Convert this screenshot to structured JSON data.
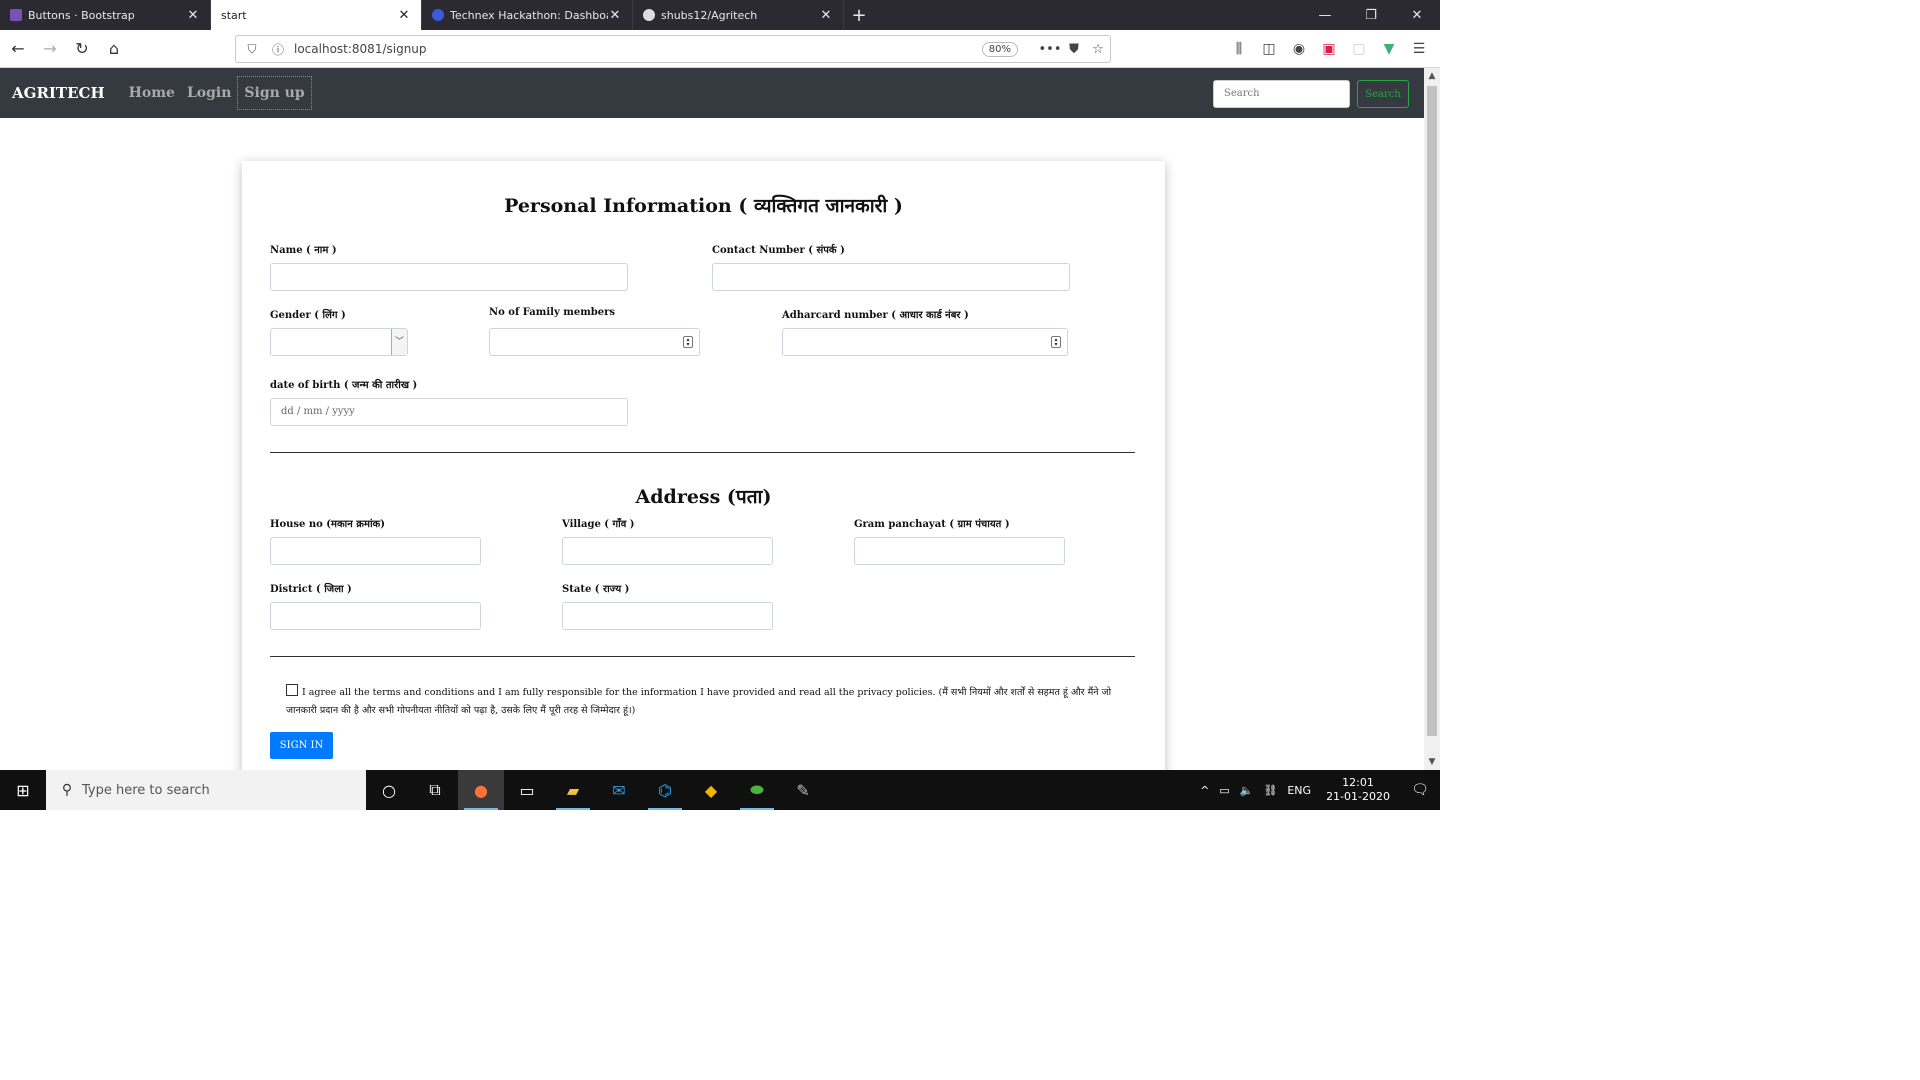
{
  "browser": {
    "tabs": [
      {
        "label": "Buttons · Bootstrap",
        "favicon_color": "#7952b3",
        "active": false
      },
      {
        "label": "start",
        "favicon_color": "#ffffff",
        "active": true
      },
      {
        "label": "Technex Hackathon: Dashboard",
        "favicon_color": "#3b5bdb",
        "active": false
      },
      {
        "label": "shubs12/Agritech",
        "favicon_color": "#ffffff",
        "active": false
      }
    ],
    "url": "localhost:8081/signup",
    "zoom": "80%"
  },
  "site": {
    "brand": "AGRITECH",
    "nav": {
      "home": "Home",
      "login": "Login",
      "signup": "Sign up"
    },
    "search_placeholder": "Search",
    "search_button": "Search"
  },
  "form": {
    "personal_title": "Personal Information ( व्यक्तिगत जानकारी )",
    "name_label": "Name ( नाम )",
    "contact_label": "Contact Number ( संपर्क )",
    "gender_label": "Gender ( लिंग )",
    "family_label": "No of Family members",
    "adhar_label": "Adharcard number ( आधार कार्ड नंबर )",
    "dob_label": "date of birth ( जन्म की तारीख )",
    "dob_placeholder": "dd / mm / yyyy",
    "address_title": "Address (पता)",
    "house_label": "House no (मकान क्रमांक)",
    "village_label": "Village ( गाँव )",
    "gram_label": "Gram panchayat ( ग्राम पंचायत )",
    "district_label": "District ( जिला )",
    "state_label": "State ( राज्य )",
    "agree_text": "I agree all the terms and conditions and I am fully responsible for the information I have provided and read all the privacy policies. (मैं सभी नियमों और शर्तों से सहमत हूं और मैंने जो जानकारी प्रदान की है और सभी गोपनीयता नीतियों को पढ़ा है, उसके लिए मैं पूरी तरह से जिम्मेदार हूं।)",
    "submit": "SIGN IN"
  },
  "taskbar": {
    "search_placeholder": "Type here to search",
    "lang": "ENG",
    "time": "12:01",
    "date": "21-01-2020"
  }
}
